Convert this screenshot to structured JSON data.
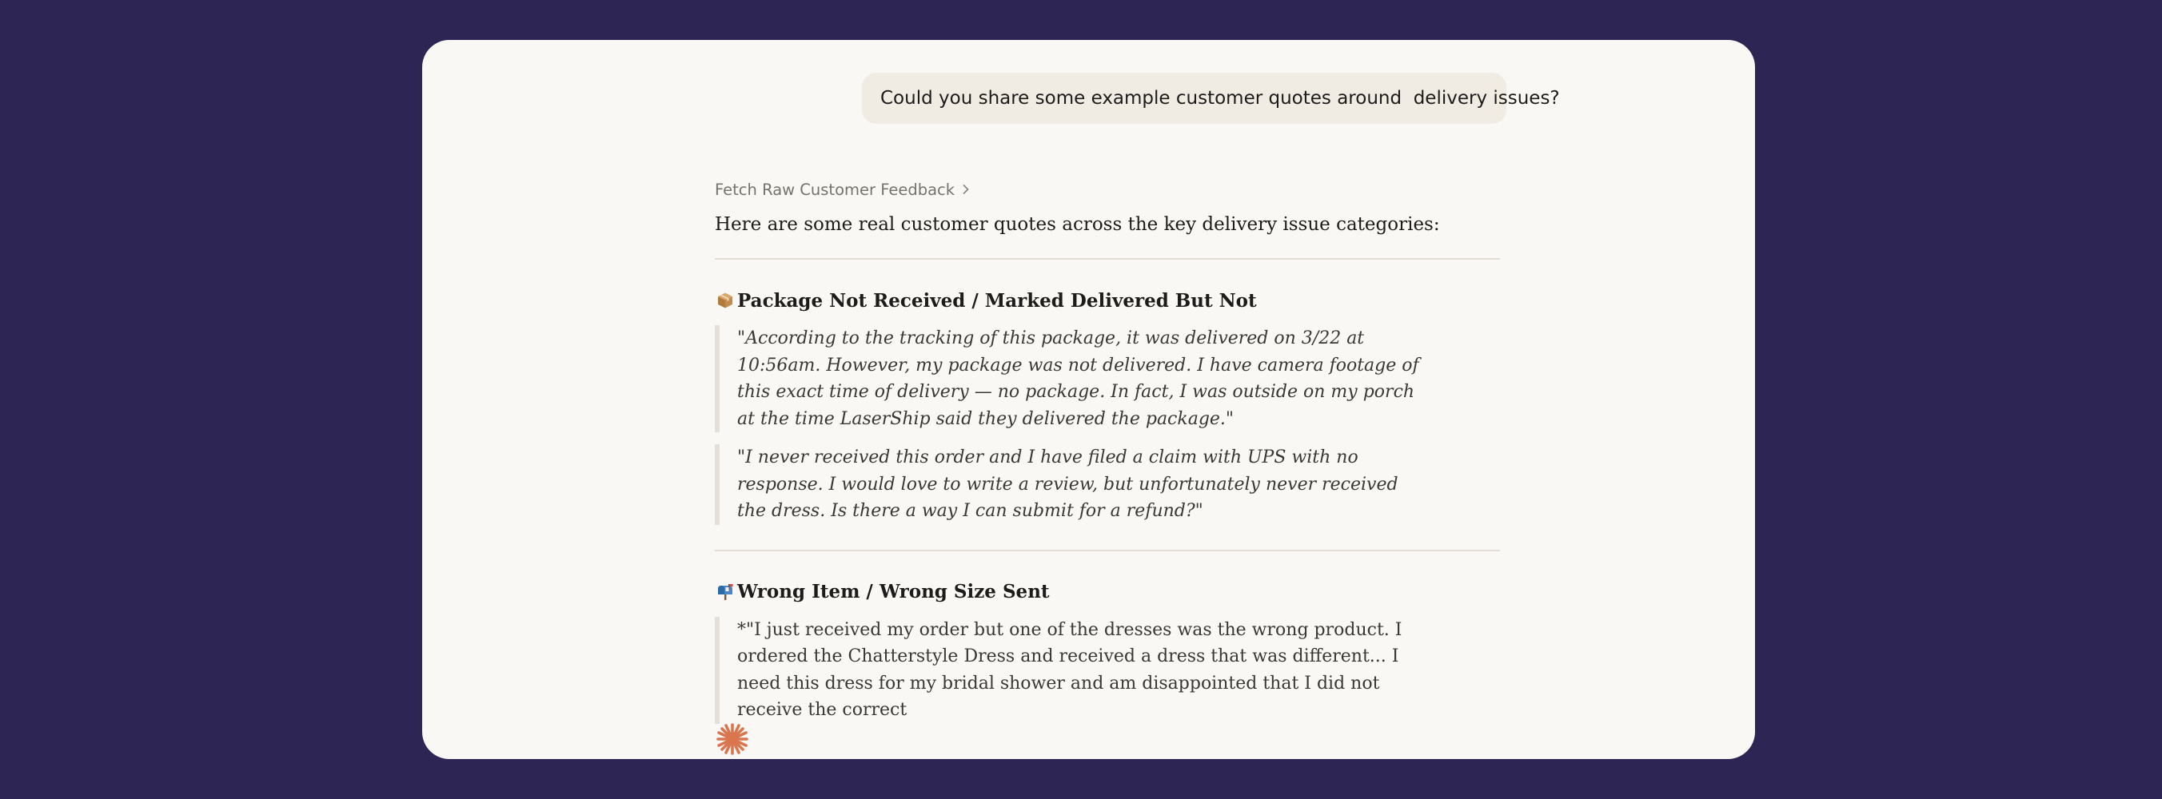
{
  "user_message": "Could you share some example customer quotes around  delivery issues?",
  "tool_call": {
    "label": "Fetch Raw Customer Feedback"
  },
  "assistant": {
    "intro": "Here are some real customer quotes across the key delivery issue categories:",
    "sections": [
      {
        "icon": "package-icon",
        "title": "Package Not Received / Marked Delivered But Not",
        "quotes": [
          "\"According to the tracking of this package, it was delivered on 3/22 at 10:56am. However, my package was not delivered. I have camera footage of this exact time of delivery — no package. In fact, I was outside on my porch at the time LaserShip said they delivered the package.\"",
          "\"I never received this order and I have filed a claim with UPS with no response. I would love to write a review, but unfortunately never received the dress. Is there a way I can submit for a refund?\""
        ]
      },
      {
        "icon": "mailbox-icon",
        "title": "Wrong Item / Wrong Size Sent",
        "quotes": [
          "*\"I just received my order but one of the dresses was the wrong product. I ordered the Chatterstyle Dress and received a dress that was different... I need this dress for my bridal shower and am disappointed that I did not receive the correct"
        ]
      }
    ]
  },
  "colors": {
    "background": "#2d2654",
    "window": "#faf8f4",
    "bubble": "#f0ebe3",
    "accent": "#d9764f"
  }
}
